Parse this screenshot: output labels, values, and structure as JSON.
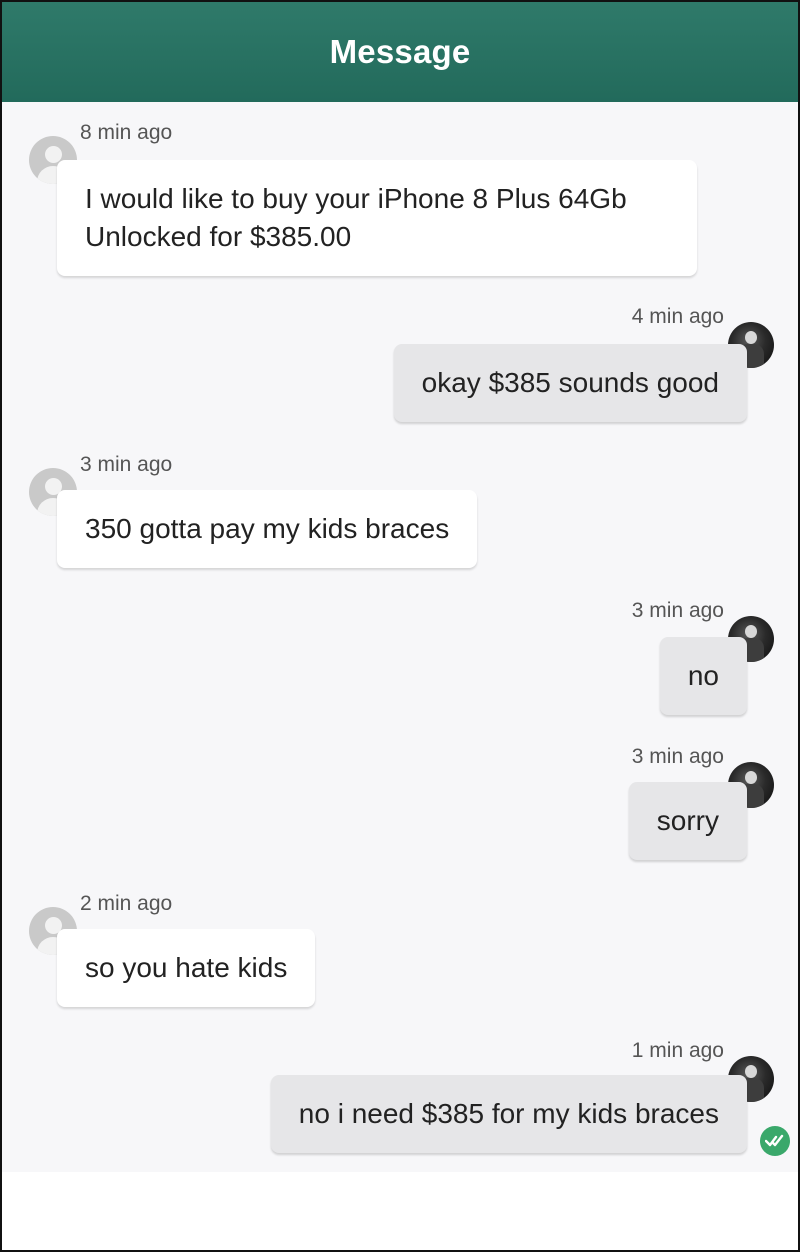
{
  "header": {
    "title": "Message"
  },
  "messages": [
    {
      "direction": "incoming",
      "time": "8 min ago",
      "text_lines": [
        "I would like to buy your iPhone 8 Plus 64Gb",
        "Unlocked for $385.00"
      ]
    },
    {
      "direction": "outgoing",
      "time": "4 min ago",
      "text": "okay $385 sounds good"
    },
    {
      "direction": "incoming",
      "time": "3 min ago",
      "text": "350 gotta pay my kids braces"
    },
    {
      "direction": "outgoing",
      "time": "3 min ago",
      "text": "no"
    },
    {
      "direction": "outgoing",
      "time": "3 min ago",
      "text": "sorry"
    },
    {
      "direction": "incoming",
      "time": "2 min ago",
      "text": "so you hate kids"
    },
    {
      "direction": "outgoing",
      "time": "1 min ago",
      "text": "no i need $385 for my kids braces",
      "read_receipt_icon": "double-check-icon"
    }
  ],
  "colors": {
    "header": "#226a5b",
    "read_receipt": "#3aa86b"
  }
}
